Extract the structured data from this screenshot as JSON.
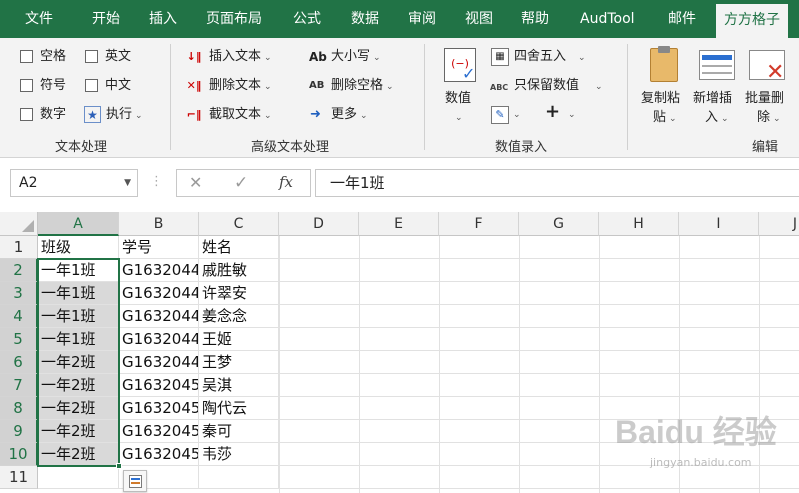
{
  "menu": {
    "items": [
      "文件",
      "开始",
      "插入",
      "页面布局",
      "公式",
      "数据",
      "审阅",
      "视图",
      "帮助",
      "AudTool",
      "邮件",
      "方方格子"
    ],
    "active_index": 11
  },
  "ribbon": {
    "text_group": {
      "label": "文本处理",
      "items": [
        "空格",
        "英文",
        "符号",
        "中文",
        "数字",
        "执行"
      ]
    },
    "adv_group": {
      "label": "高级文本处理",
      "insert": "插入文本",
      "delete": "删除文本",
      "extract": "截取文本",
      "case": "大小写",
      "remove_space": "删除空格",
      "more": "更多",
      "icon_ab": "Ab",
      "icon_ab2": "AB"
    },
    "num_group": {
      "label": "数值录入",
      "value": "数值",
      "round": "四舍五入",
      "keep_value": "只保留数值",
      "abc": "ABC",
      "plus": "+"
    },
    "edit_group": {
      "label": "编辑",
      "copy_line1": "复制粘",
      "copy_line2": "贴",
      "insert_line1": "新增插",
      "insert_line2": "入",
      "del_line1": "批量删",
      "del_line2": "除"
    }
  },
  "formula_bar": {
    "name_box": "A2",
    "fx": "fx",
    "cancel": "✕",
    "confirm": "✓",
    "dots": "⋮",
    "formula": "一年1班"
  },
  "grid": {
    "columns": [
      "A",
      "B",
      "C",
      "D",
      "E",
      "F",
      "G",
      "H",
      "I",
      "J"
    ],
    "rows": [
      "1",
      "2",
      "3",
      "4",
      "5",
      "6",
      "7",
      "8",
      "9",
      "10",
      "11"
    ],
    "data": [
      [
        "班级",
        "学号",
        "姓名"
      ],
      [
        "一年1班",
        "G1632044",
        "戚胜敏"
      ],
      [
        "一年1班",
        "G1632044",
        "许翠安"
      ],
      [
        "一年1班",
        "G1632044",
        "姜念念"
      ],
      [
        "一年1班",
        "G1632044",
        "王姬"
      ],
      [
        "一年2班",
        "G1632044",
        "王梦"
      ],
      [
        "一年2班",
        "G1632045",
        "吴淇"
      ],
      [
        "一年2班",
        "G1632045",
        "陶代云"
      ],
      [
        "一年2班",
        "G1632045",
        "秦可"
      ],
      [
        "一年2班",
        "G1632045",
        "韦莎"
      ]
    ]
  },
  "watermark": {
    "brand": "Baidu 经验",
    "url": "jingyan.baidu.com"
  },
  "colors": {
    "accent": "#217346",
    "selection": "#d9d9d9"
  }
}
